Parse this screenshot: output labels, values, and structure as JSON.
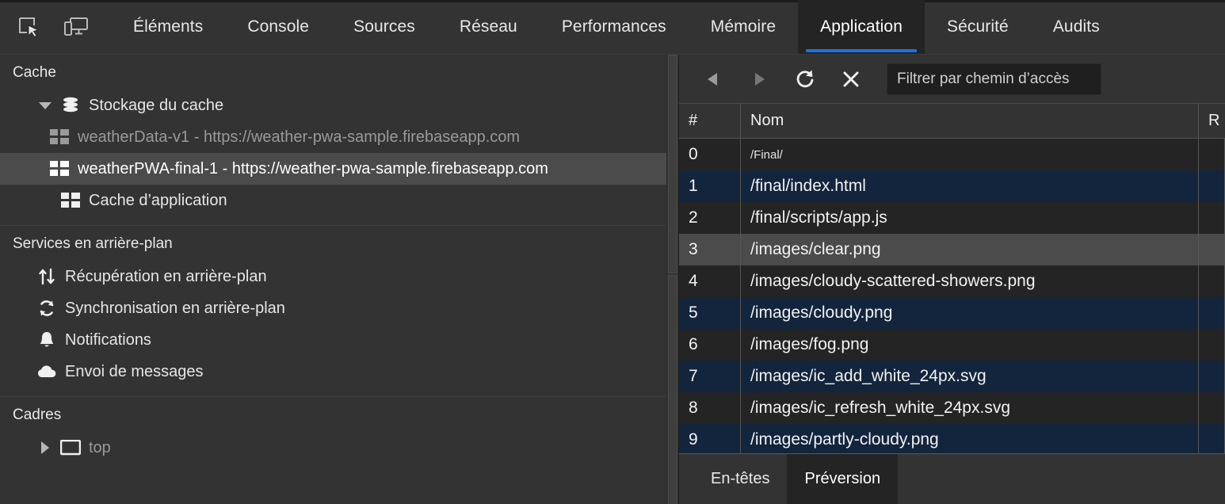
{
  "toolbar_icons": [
    {
      "name": "inspect-element-icon"
    },
    {
      "name": "device-toolbar-icon"
    }
  ],
  "tabs": [
    {
      "label": "Éléments",
      "active": false
    },
    {
      "label": "Console",
      "active": false
    },
    {
      "label": "Sources",
      "active": false
    },
    {
      "label": "Réseau",
      "active": false
    },
    {
      "label": "Performances",
      "active": false
    },
    {
      "label": "Mémoire",
      "active": false
    },
    {
      "label": "Application",
      "active": true
    },
    {
      "label": "Sécurité",
      "active": false
    },
    {
      "label": "Audits",
      "active": false
    }
  ],
  "accent_color": "#1a73e8",
  "sidebar": {
    "sections": [
      {
        "title": "Cache",
        "items": [
          {
            "label": "Stockage du cache",
            "icon": "database-icon",
            "caret": "open",
            "indent": 1,
            "state": "normal"
          },
          {
            "label": "weatherData-v1 - https://weather-pwa-sample.firebaseapp.com",
            "icon": "grid-table-icon",
            "indent": 2,
            "state": "dimmed"
          },
          {
            "label": "weatherPWA-final-1 - https://weather-pwa-sample.firebaseapp.com",
            "icon": "grid-table-icon",
            "indent": 2,
            "state": "selected"
          },
          {
            "label": "Cache d’application",
            "icon": "grid-table-icon",
            "indent": 1,
            "state": "normal"
          }
        ]
      },
      {
        "title": "Services en arrière-plan",
        "items": [
          {
            "label": "Récupération en arrière-plan",
            "icon": "up-down-arrows-icon",
            "indent": 1,
            "state": "normal"
          },
          {
            "label": "Synchronisation en arrière-plan",
            "icon": "sync-icon",
            "indent": 1,
            "state": "normal"
          },
          {
            "label": "Notifications",
            "icon": "bell-icon",
            "indent": 1,
            "state": "normal"
          },
          {
            "label": "Envoi de messages",
            "icon": "cloud-icon",
            "indent": 1,
            "state": "normal"
          }
        ]
      },
      {
        "title": "Cadres",
        "items": [
          {
            "label": "top",
            "icon": "frame-icon",
            "caret": "closed",
            "indent": 1,
            "state": "dimmed"
          }
        ]
      }
    ]
  },
  "cache_panel": {
    "toolbar": {
      "back_icon": "back-triangle-icon",
      "forward_icon": "forward-triangle-icon",
      "refresh_icon": "refresh-icon",
      "clear_icon": "close-x-icon",
      "filter_placeholder": "Filtrer par chemin d’accès",
      "filter_value": ""
    },
    "columns": [
      "#",
      "Nom",
      "R"
    ],
    "rows": [
      {
        "num": "0",
        "name": "/Final/",
        "style": "small",
        "highlight": "none"
      },
      {
        "num": "1",
        "name": "/final/index.html",
        "style": "normal",
        "highlight": "odd"
      },
      {
        "num": "2",
        "name": "/final/scripts/app.js",
        "style": "normal",
        "highlight": "none"
      },
      {
        "num": "3",
        "name": "/images/clear.png",
        "style": "normal",
        "highlight": "hover"
      },
      {
        "num": "4",
        "name": "/images/cloudy-scattered-showers.png",
        "style": "normal",
        "highlight": "none"
      },
      {
        "num": "5",
        "name": "/images/cloudy.png",
        "style": "normal",
        "highlight": "odd"
      },
      {
        "num": "6",
        "name": "/images/fog.png",
        "style": "normal",
        "highlight": "none"
      },
      {
        "num": "7",
        "name": "/images/ic_add_white_24px.svg",
        "style": "normal",
        "highlight": "odd"
      },
      {
        "num": "8",
        "name": "/images/ic_refresh_white_24px.svg",
        "style": "normal",
        "highlight": "none"
      },
      {
        "num": "9",
        "name": "/images/partly-cloudy.png",
        "style": "normal",
        "highlight": "odd"
      }
    ],
    "drawer_tabs": [
      {
        "label": "En-têtes",
        "active": false
      },
      {
        "label": "Préversion",
        "active": true
      }
    ]
  }
}
